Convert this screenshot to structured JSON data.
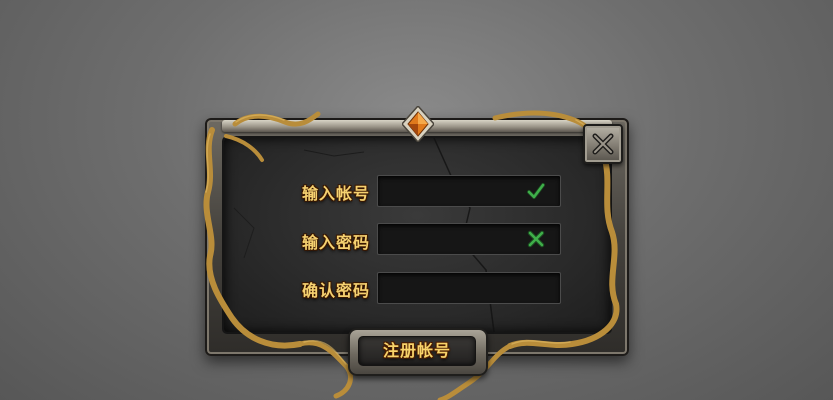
{
  "dialog": {
    "fields": [
      {
        "label": "输入帐号",
        "value": "",
        "status": "valid",
        "status_icon": "check-icon",
        "status_color": "#3fae4a"
      },
      {
        "label": "输入密码",
        "value": "",
        "status": "invalid",
        "status_icon": "cross-icon",
        "status_color": "#3fae4a"
      },
      {
        "label": "确认密码",
        "value": "",
        "status": "none"
      }
    ],
    "submit_label": "注册帐号",
    "close_icon": "close-icon"
  },
  "colors": {
    "label_gold": "#f5d170",
    "vine_gold": "#b98d3a",
    "gem_orange": "#e07a1c",
    "stone_frame": "#6e6a62"
  }
}
